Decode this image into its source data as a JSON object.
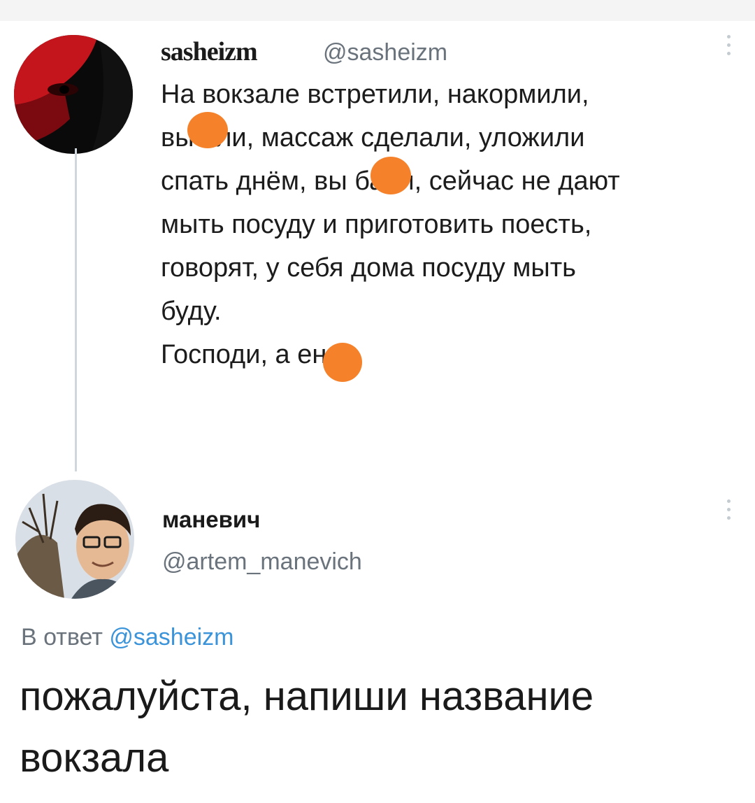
{
  "original_tweet": {
    "display_name": "sasheizm",
    "handle": "@sasheizm",
    "text_lines": [
      "На вокзале встретили, накормили,",
      "вы    али, массаж сделали, уложили",
      "спать днём, вы    бали, сейчас не дают",
      "мыть посуду и приготовить поесть,",
      "говорят, у себя дома посуду мыть",
      "буду.",
      "Господи, а    енно"
    ],
    "more_icon": "more-vertical-icon"
  },
  "reply_tweet": {
    "display_name": "маневич",
    "handle": "@artem_manevich",
    "reply_prefix": "В ответ",
    "reply_mention": "@sasheizm",
    "text_lines": [
      "пожалуйста, напиши название",
      "вокзала"
    ],
    "more_icon": "more-vertical-icon"
  },
  "colors": {
    "censor_blob": "#f5822a",
    "mention": "#3b94d9",
    "muted": "#6a737c",
    "thread_line": "#cfd6dc"
  }
}
